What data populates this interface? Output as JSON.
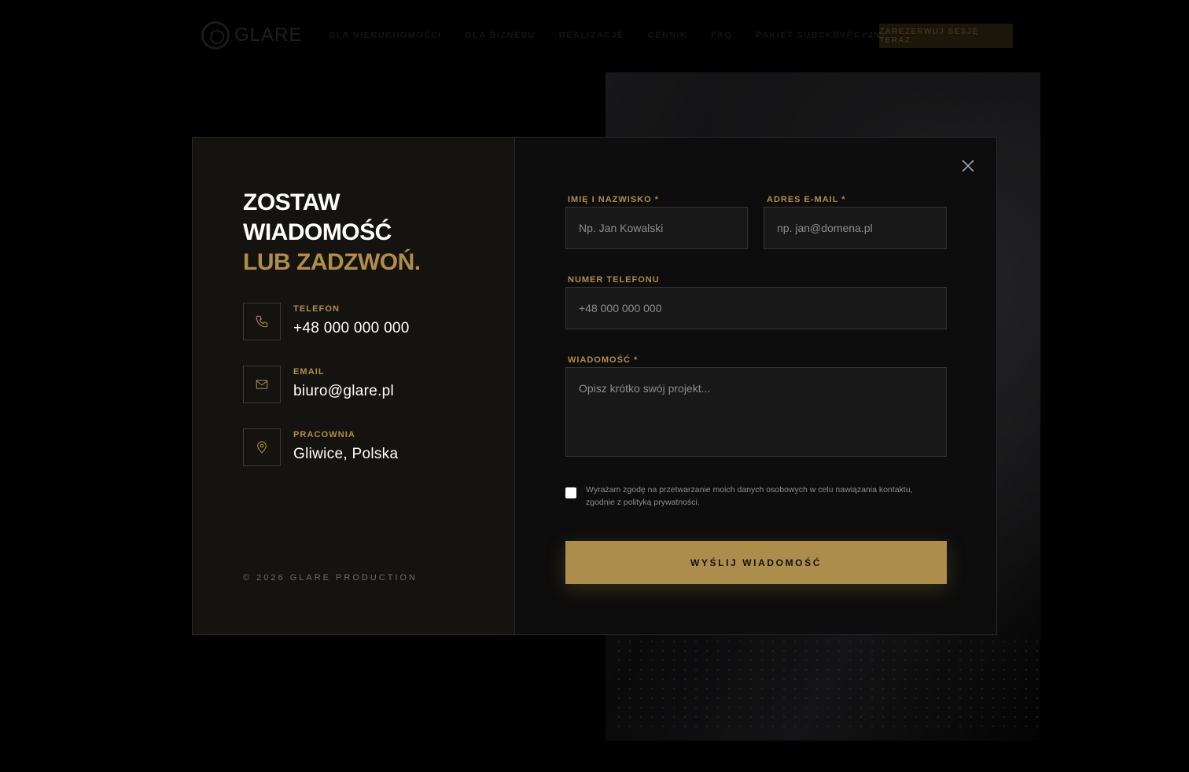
{
  "background": {
    "logo_text": "GLARE",
    "nav_links": [
      "DLA NIERUCHOMOŚCI",
      "DLA BIZNESU",
      "REALIZACJE",
      "CENNIK",
      "FAQ",
      "PAKIET SUBSKRYPCYJNY"
    ],
    "cta_label": "ZAREZERWUJ SESJĘ TERAZ"
  },
  "modal": {
    "heading": {
      "line1": "ZOSTAW",
      "line2": "WIADOMOŚĆ",
      "line3": "LUB ZADZWOŃ."
    },
    "contacts": [
      {
        "icon": "phone-icon",
        "label": "TELEFON",
        "value": "+48 000 000 000"
      },
      {
        "icon": "mail-icon",
        "label": "EMAIL",
        "value": "biuro@glare.pl"
      },
      {
        "icon": "location-pin-icon",
        "label": "PRACOWNIA",
        "value": "Gliwice, Polska"
      }
    ],
    "copyright": "© 2026 GLARE PRODUCTION",
    "form": {
      "name": {
        "label": "IMIĘ I NAZWISKO *",
        "placeholder": "Np. Jan Kowalski",
        "value": ""
      },
      "email": {
        "label": "ADRES E-MAIL *",
        "placeholder": "np. jan@domena.pl",
        "value": ""
      },
      "phone": {
        "label": "NUMER TELEFONU",
        "placeholder": "+48 000 000 000",
        "value": ""
      },
      "message": {
        "label": "WIADOMOŚĆ *",
        "placeholder": "Opisz krótko swój projekt...",
        "value": ""
      },
      "consent_text": "Wyrażam zgodę na przetwarzanie moich danych osobowych w celu nawiązania kontaktu, zgodnie z polityką prywatności.",
      "consent_checked": false,
      "submit_label": "WYŚLIJ WIADOMOŚĆ"
    }
  },
  "colors": {
    "accent": "#b08d4b",
    "button": "#ad8d4b",
    "left_panel": "#141310",
    "right_panel": "#0d0d0d",
    "input_bg": "#181818"
  }
}
